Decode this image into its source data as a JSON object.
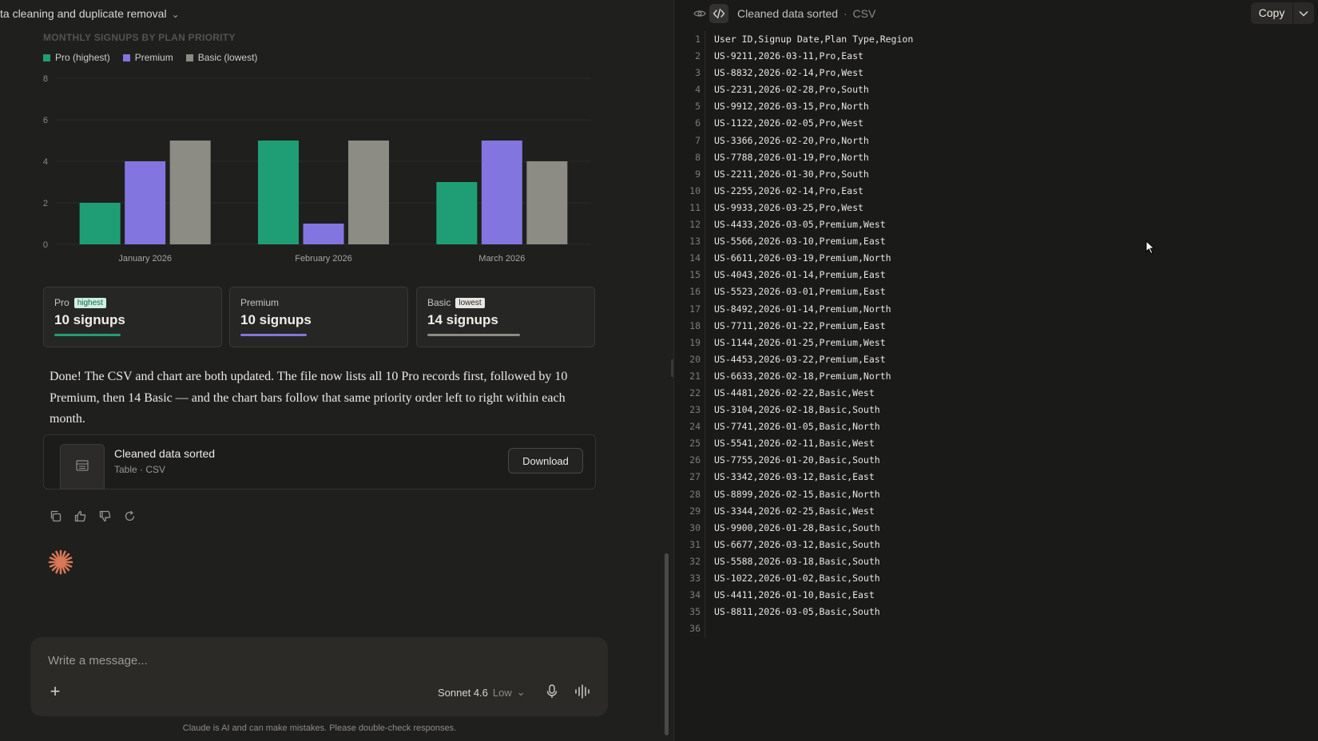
{
  "conversation": {
    "title": "ta cleaning and duplicate removal"
  },
  "chart_data": {
    "type": "bar",
    "title": "MONTHLY SIGNUPS BY PLAN PRIORITY",
    "categories": [
      "January 2026",
      "February 2026",
      "March 2026"
    ],
    "series": [
      {
        "name": "Pro (highest)",
        "color": "#1f9e75",
        "values": [
          2,
          5,
          3
        ]
      },
      {
        "name": "Premium",
        "color": "#8375e0",
        "values": [
          4,
          1,
          5
        ]
      },
      {
        "name": "Basic (lowest)",
        "color": "#8c8b84",
        "values": [
          5,
          5,
          4
        ]
      }
    ],
    "ylim": [
      0,
      8
    ],
    "yticks": [
      "0",
      "2",
      "4",
      "6",
      "8"
    ],
    "grid": true,
    "legend": "top-left"
  },
  "stats": [
    {
      "name": "Pro",
      "badge": "highest",
      "count": "10 signups",
      "color": "#1f9e75",
      "fraction": 0.5
    },
    {
      "name": "Premium",
      "badge": "",
      "count": "10 signups",
      "color": "#8375e0",
      "fraction": 0.5
    },
    {
      "name": "Basic",
      "badge": "lowest",
      "count": "14 signups",
      "color": "#8c8b84",
      "fraction": 0.7
    }
  ],
  "message": "Done! The CSV and chart are both updated. The file now lists all 10 Pro records first, followed by 10 Premium, then 14 Basic — and the chart bars follow that same priority order left to right within each month.",
  "artifact": {
    "name": "Cleaned data sorted",
    "meta": "Table · CSV",
    "download_label": "Download"
  },
  "actions": [
    "copy-icon",
    "thumbs-up-icon",
    "thumbs-down-icon",
    "retry-icon"
  ],
  "composer": {
    "placeholder": "Write a message...",
    "model": "Sonnet 4.6",
    "effort": "Low"
  },
  "disclaimer": "Claude is AI and can make mistakes. Please double-check responses.",
  "panel": {
    "title": "Cleaned data sorted",
    "separator": "·",
    "file_type": "CSV",
    "copy_label": "Copy"
  },
  "code_lines": [
    "User ID,Signup Date,Plan Type,Region",
    "US-9211,2026-03-11,Pro,East",
    "US-8832,2026-02-14,Pro,West",
    "US-2231,2026-02-28,Pro,South",
    "US-9912,2026-03-15,Pro,North",
    "US-1122,2026-02-05,Pro,West",
    "US-3366,2026-02-20,Pro,North",
    "US-7788,2026-01-19,Pro,North",
    "US-2211,2026-01-30,Pro,South",
    "US-2255,2026-02-14,Pro,East",
    "US-9933,2026-03-25,Pro,West",
    "US-4433,2026-03-05,Premium,West",
    "US-5566,2026-03-10,Premium,East",
    "US-6611,2026-03-19,Premium,North",
    "US-4043,2026-01-14,Premium,East",
    "US-5523,2026-03-01,Premium,East",
    "US-8492,2026-01-14,Premium,North",
    "US-7711,2026-01-22,Premium,East",
    "US-1144,2026-01-25,Premium,West",
    "US-4453,2026-03-22,Premium,East",
    "US-6633,2026-02-18,Premium,North",
    "US-4481,2026-02-22,Basic,West",
    "US-3104,2026-02-18,Basic,South",
    "US-7741,2026-01-05,Basic,North",
    "US-5541,2026-02-11,Basic,West",
    "US-7755,2026-01-20,Basic,South",
    "US-3342,2026-03-12,Basic,East",
    "US-8899,2026-02-15,Basic,North",
    "US-3344,2026-02-25,Basic,West",
    "US-9900,2026-01-28,Basic,South",
    "US-6677,2026-03-12,Basic,South",
    "US-5588,2026-03-18,Basic,South",
    "US-1022,2026-01-02,Basic,South",
    "US-4411,2026-01-10,Basic,East",
    "US-8811,2026-03-05,Basic,South",
    ""
  ]
}
